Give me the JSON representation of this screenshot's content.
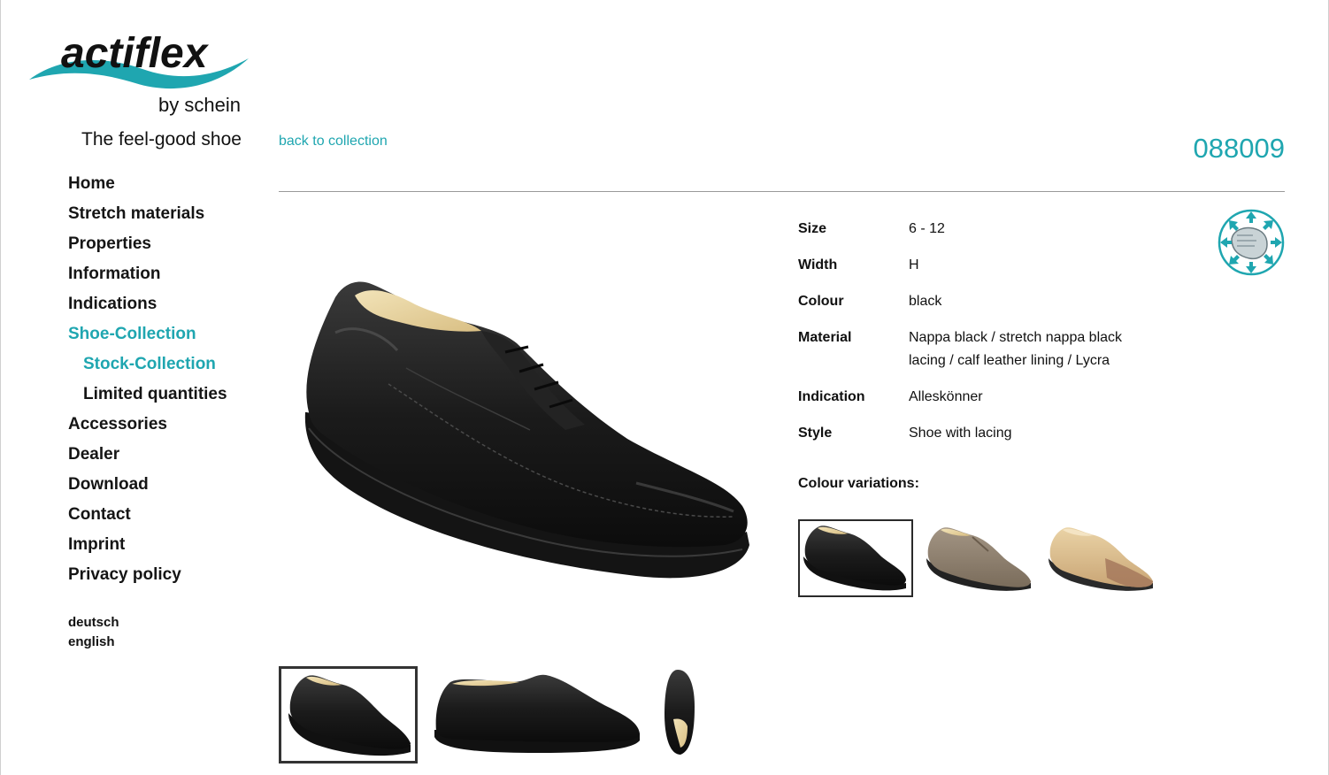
{
  "brand": {
    "logo_text_main": "actiflex",
    "logo_text_sub": "by schein",
    "tagline": "The feel-good shoe"
  },
  "nav": {
    "items": [
      {
        "label": "Home"
      },
      {
        "label": "Stretch materials"
      },
      {
        "label": "Properties"
      },
      {
        "label": "Information"
      },
      {
        "label": "Indications"
      },
      {
        "label": "Shoe-Collection",
        "active": true
      },
      {
        "label": "Stock-Collection",
        "active": true,
        "sub": true
      },
      {
        "label": "Limited quantities",
        "sub": true
      },
      {
        "label": "Accessories"
      },
      {
        "label": "Dealer"
      },
      {
        "label": "Download"
      },
      {
        "label": "Contact"
      },
      {
        "label": "Imprint"
      },
      {
        "label": "Privacy policy"
      }
    ],
    "languages": [
      "deutsch",
      "english"
    ]
  },
  "header": {
    "back_link": "back to collection",
    "article_number": "088009"
  },
  "details": [
    {
      "label": "Size",
      "value": "6 - 12"
    },
    {
      "label": "Width",
      "value": "H"
    },
    {
      "label": "Colour",
      "value": "black"
    },
    {
      "label": "Material",
      "value": "Nappa black / stretch nappa black lacing / calf leather lining / Lycra"
    },
    {
      "label": "Indication",
      "value": "Alleskönner"
    },
    {
      "label": "Style",
      "value": "Shoe with lacing"
    }
  ],
  "colour_variations_label": "Colour variations:",
  "colour_variations": [
    {
      "color": "black",
      "selected": true
    },
    {
      "color": "taupe",
      "selected": false
    },
    {
      "color": "beige",
      "selected": false
    }
  ],
  "image_thumbnails": [
    {
      "view": "angled",
      "selected": true
    },
    {
      "view": "side",
      "selected": false
    },
    {
      "view": "top",
      "selected": false
    }
  ],
  "colors": {
    "accent": "#1fa6b0",
    "text": "#111111",
    "divider": "#9a9a9a"
  }
}
